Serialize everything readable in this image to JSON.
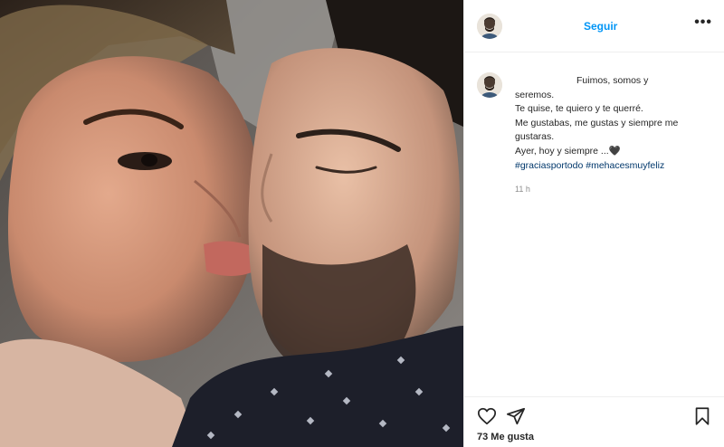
{
  "header": {
    "follow_label": "Seguir",
    "more_label": "•••",
    "avatar_icon": "profile-avatar-icon"
  },
  "caption": {
    "lines": [
      "Fuimos, somos y",
      "seremos.",
      "Te quise, te quiero y te querré.",
      "Me gustabas, me gustas y siempre me",
      "gustaras.",
      "Ayer, hoy y siempre ...🖤"
    ],
    "hashtags": [
      "#graciasportodo",
      "#mehacesmuyfeliz"
    ],
    "timestamp": "11 h"
  },
  "actions": {
    "icons": [
      "heart-icon",
      "share-icon",
      "bookmark-icon"
    ],
    "likes_text": "73 Me gusta"
  },
  "colors": {
    "link_blue": "#0095f6",
    "hashtag": "#00376b",
    "muted": "#8e8e8e",
    "text": "#262626",
    "divider": "#efefef"
  }
}
